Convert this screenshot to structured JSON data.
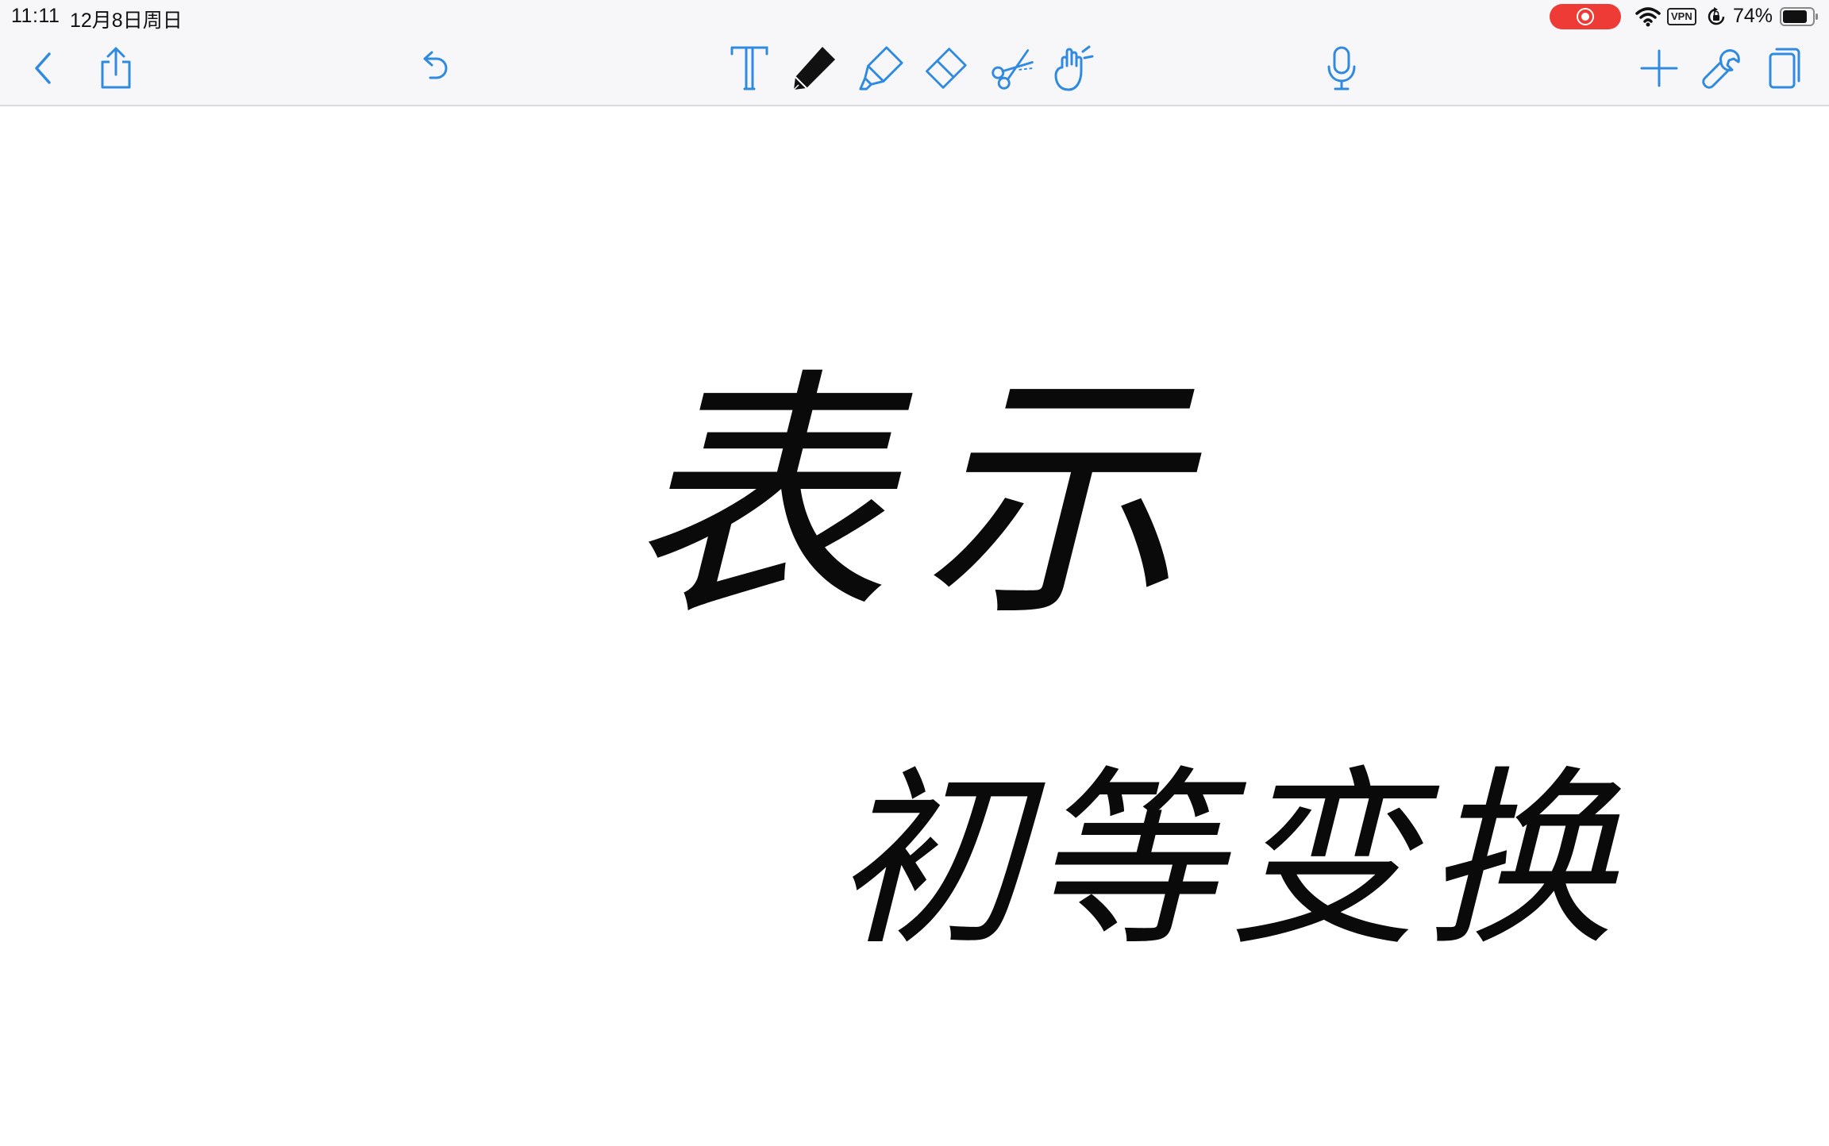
{
  "status_bar": {
    "time": "11:11",
    "date": "12月8日周日",
    "vpn": "VPN",
    "battery": "74%"
  },
  "toolbar": {
    "left": [
      "back-icon",
      "share-icon",
      "undo-icon"
    ],
    "tools": [
      "text-tool-icon",
      "pen-tool-icon",
      "highlighter-icon",
      "eraser-icon",
      "scissors-icon",
      "hand-icon"
    ],
    "center": [
      "microphone-icon"
    ],
    "right": [
      "add-icon",
      "wrench-icon",
      "pages-icon"
    ],
    "active_tool": "pen-tool-icon",
    "accent_color": "#2f8ae0",
    "recording_color": "#ee3b35"
  },
  "canvas": {
    "line1": "表示",
    "line2": "初等变换"
  }
}
